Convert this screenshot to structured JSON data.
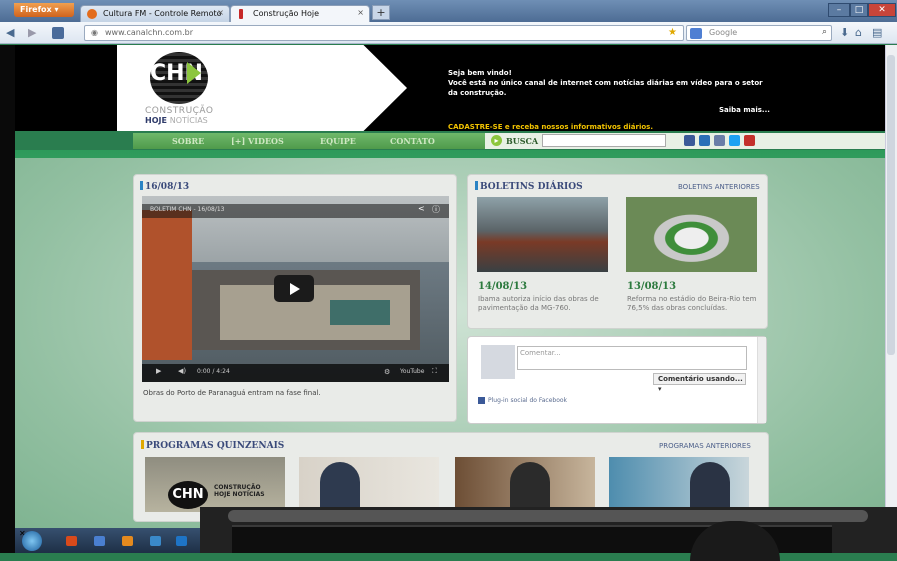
{
  "browser": {
    "firefox_label": "Firefox",
    "tabs": [
      {
        "title": "Cultura FM - Controle Remoto",
        "close": "×"
      },
      {
        "title": "Construção Hoje",
        "close": "×"
      }
    ],
    "new_tab": "+",
    "url": "www.canalchn.com.br",
    "search_placeholder": "Google"
  },
  "site": {
    "logo": {
      "mark": "CHN",
      "line1": "CONSTRUÇÃO",
      "line2_bold": "HOJE",
      "line2_light": "NOTÍCIAS"
    },
    "welcome": {
      "title": "Seja bem vindo!",
      "text": "Você está no único canal de internet com notícias diárias em vídeo para o setor da construção.",
      "more": "Saiba mais...",
      "signup": "CADASTRE-SE e receba nossos informativos diários."
    },
    "menu": [
      "SOBRE",
      "[+] VIDEOS",
      "EQUIPE",
      "CONTATO"
    ],
    "search_label": "BUSCA",
    "featured": {
      "date": "16/08/13",
      "video_title": "BOLETIM CHN - 16/08/13",
      "time": "0:00 / 4:24",
      "youtube": "YouTube",
      "caption": "Obras do Porto de Paranaguá entram na fase final."
    },
    "boletins": {
      "title": "BOLETINS DIÁRIOS",
      "link": "BOLETINS ANTERIORES",
      "items": [
        {
          "date": "14/08/13",
          "desc": "Ibama autoriza início das obras de pavimentação da MG-760."
        },
        {
          "date": "13/08/13",
          "desc": "Reforma no estádio do Beira-Rio tem 76,5% das obras concluídas."
        }
      ]
    },
    "facebook": {
      "placeholder": "Comentar...",
      "button": "Comentário usando...",
      "plugin": "Plug-in social do Facebook"
    },
    "programas": {
      "title": "PROGRAMAS QUINZENAIS",
      "link": "PROGRAMAS ANTERIORES",
      "thumb_logo": "CHN",
      "thumb_text": "CONSTRUÇÃO HOJE NOTÍCIAS"
    }
  },
  "colors": {
    "header": "#000000",
    "menu": "#5aa955",
    "accent_green": "#2c7a3e",
    "title_blue": "#3a4a7a"
  }
}
